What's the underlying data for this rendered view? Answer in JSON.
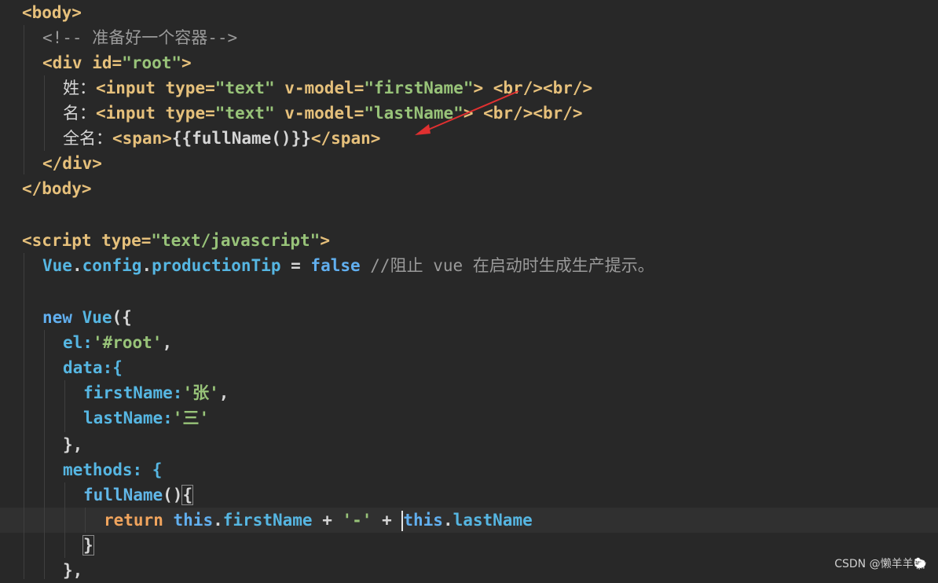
{
  "code_lines": [
    "<body>",
    "  <!-- 准备好一个容器-->",
    "  <div id=\"root\">",
    "    姓：<input type=\"text\" v-model=\"firstName\"> <br/><br/>",
    "    名：<input type=\"text\" v-model=\"lastName\"> <br/><br/>",
    "    全名：<span>{{fullName()}}</span>",
    "  </div>",
    "</body>",
    "",
    "<script type=\"text/javascript\">",
    "  Vue.config.productionTip = false //阻止 vue 在启动时生成生产提示。",
    "",
    "  new Vue({",
    "    el:'#root',",
    "    data:{",
    "      firstName:'张',",
    "      lastName:'三'",
    "    },",
    "    methods: {",
    "      fullName(){",
    "        return this.firstName + '-' + this.lastName",
    "      }",
    "    },"
  ],
  "tokens": {
    "body_open": "<body>",
    "comment": "<!-- 准备好一个容器-->",
    "div_open_a": "<div ",
    "div_id_attr": "id=",
    "div_id_val": "\"root\"",
    "div_open_b": ">",
    "label_first": "姓：",
    "label_last": "名：",
    "label_full": "全名：",
    "input_open": "<input ",
    "type_attr": "type=",
    "type_val": "\"text\"",
    "vmodel_attr": " v-model=",
    "first_val": "\"firstName\"",
    "last_val": "\"lastName\"",
    "input_close": ">",
    "br_pair": " <br/><br/>",
    "span_open": "<span>",
    "mustache": "{{fullName()}}",
    "span_close": "</span>",
    "div_close": "</div>",
    "body_close": "</body>",
    "script_open_a": "<script ",
    "script_type_val": "\"text/javascript\"",
    "script_open_b": ">",
    "vue_obj": "Vue",
    "dot": ".",
    "config": "config",
    "production_tip": "productionTip",
    "assign": " = ",
    "false_kw": "false",
    "comment_js": " //阻止 vue 在启动时生成生产提示。",
    "new_kw": "new ",
    "vue_ctor": "Vue",
    "open_call": "({",
    "el_key": "el:",
    "el_val": "'#root'",
    "comma": ",",
    "data_key": "data:{",
    "first_key": "firstName:",
    "first_str": "'张'",
    "last_key": "lastName:",
    "last_str": "'三'",
    "close_brace_comma": "},",
    "methods_key": "methods: {",
    "fullname_fn": "fullName",
    "fn_parens": "()",
    "open_brace": "{",
    "return_kw": "return ",
    "this_kw": "this",
    "first_prop": "firstName",
    "plus": " + ",
    "dash_str": "'-'",
    "plus2": " + ",
    "last_prop": "lastName",
    "close_brace": "}"
  },
  "watermark": "CSDN @懒羊羊🐑",
  "colors": {
    "background": "#282828",
    "annotation_arrow": "#e03030"
  }
}
